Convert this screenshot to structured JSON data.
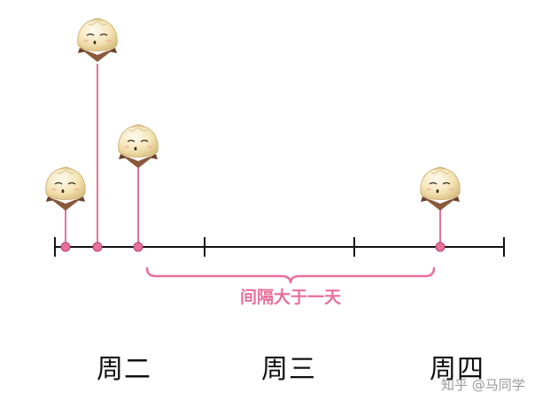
{
  "days": [
    {
      "id": "tue",
      "label": "周二"
    },
    {
      "id": "wed",
      "label": "周三"
    },
    {
      "id": "thu",
      "label": "周四"
    }
  ],
  "gap_annotation": {
    "label": "间隔大于一天"
  },
  "watermark": "知乎 @马同学",
  "colors": {
    "accent": "#e8709a",
    "axis": "#111111",
    "dumpling_body": "#f4e5b6",
    "dumpling_shadow": "#e2c98a",
    "cape": "#8b5a3c"
  },
  "icons": {
    "event_marker": "baozi-dumpling-icon"
  },
  "events_count": 4
}
